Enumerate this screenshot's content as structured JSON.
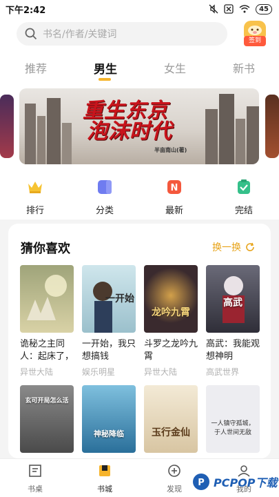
{
  "status_bar": {
    "time": "下午2:42",
    "battery": "45"
  },
  "search": {
    "placeholder": "书名/作者/关键词"
  },
  "signin": {
    "label": "签到"
  },
  "tabs": [
    {
      "label": "推荐"
    },
    {
      "label": "男生"
    },
    {
      "label": "女生"
    },
    {
      "label": "新书"
    }
  ],
  "banner": {
    "title_line1": "重生东京",
    "title_line2": "泡沫时代",
    "author": "半亩南山(著)"
  },
  "quick_links": [
    {
      "label": "排行",
      "icon": "crown-icon",
      "color": "#f6c332"
    },
    {
      "label": "分类",
      "icon": "category-icon",
      "color": "#6f7cf0"
    },
    {
      "label": "最新",
      "icon": "new-icon",
      "color": "#f4583d"
    },
    {
      "label": "完结",
      "icon": "completed-icon",
      "color": "#35c08a"
    }
  ],
  "guess": {
    "title": "猜你喜欢",
    "refresh_label": "换一换",
    "books": [
      {
        "title": "诡秘之主同人：起床了，",
        "genre": "异世大陆",
        "cover_text": "",
        "cover_bg": "#c8c39b"
      },
      {
        "title": "一开始，我只想搞钱",
        "genre": "娱乐明星",
        "cover_text": "一开始",
        "cover_bg": "#b7d7e0"
      },
      {
        "title": "斗罗之龙吟九霄",
        "genre": "异世大陆",
        "cover_text": "龙吟九霄",
        "cover_bg": "#3a2a2e"
      },
      {
        "title": "高武：我能观想神明",
        "genre": "高武世界",
        "cover_text": "高武",
        "cover_bg": "#4b4a56"
      },
      {
        "title": "",
        "genre": "",
        "cover_text": "玄可开局怎么活",
        "cover_bg": "#6d6d6d"
      },
      {
        "title": "",
        "genre": "",
        "cover_text": "神秘降临",
        "cover_bg": "#2f7aa3"
      },
      {
        "title": "",
        "genre": "",
        "cover_text": "玉行金仙",
        "cover_bg": "#e8d9bd"
      },
      {
        "title": "",
        "genre": "",
        "cover_text": "一人镇守孤城，于人世间无敌",
        "cover_bg": "#e9e9ee"
      }
    ]
  },
  "bottom_nav": [
    {
      "label": "书桌",
      "icon": "bookshelf-icon"
    },
    {
      "label": "书城",
      "icon": "bookstore-icon"
    },
    {
      "label": "发现",
      "icon": "discover-icon"
    },
    {
      "label": "我的",
      "icon": "profile-icon"
    }
  ],
  "watermark": {
    "text": "PCPOP下载"
  }
}
